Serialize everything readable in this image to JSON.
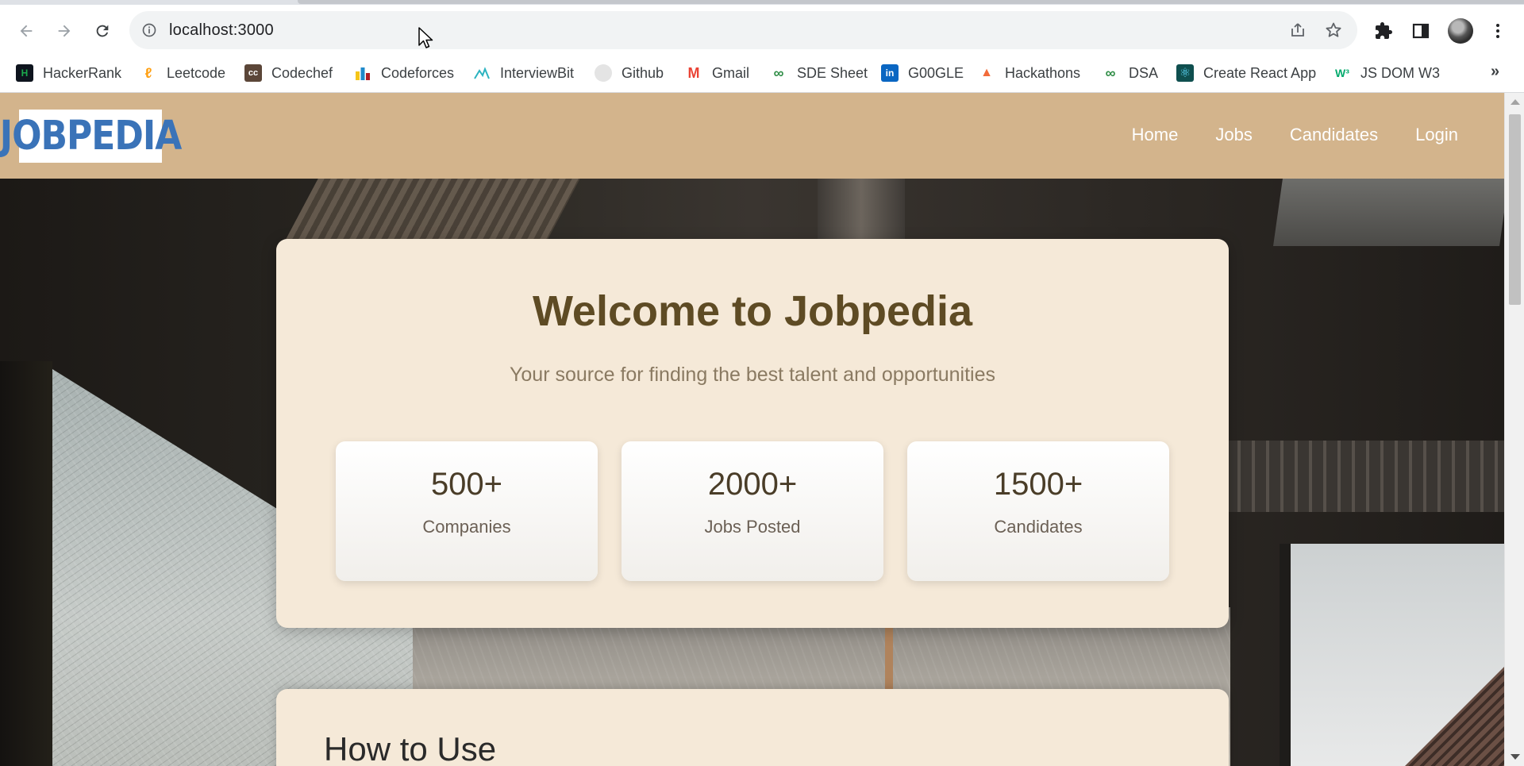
{
  "browser": {
    "url": "localhost:3000",
    "bookmarks": [
      {
        "label": "HackerRank",
        "icon": "hackerrank-icon",
        "color": "#1ba94c",
        "glyph": "H"
      },
      {
        "label": "Leetcode",
        "icon": "leetcode-icon",
        "color": "#ffa116",
        "glyph": "L"
      },
      {
        "label": "Codechef",
        "icon": "codechef-icon",
        "color": "#5b4638",
        "glyph": "cc"
      },
      {
        "label": "Codeforces",
        "icon": "codeforces-icon",
        "color": "#1f8acb",
        "glyph": ""
      },
      {
        "label": "InterviewBit",
        "icon": "interviewbit-icon",
        "color": "#2bb3c0",
        "glyph": ""
      },
      {
        "label": "Github",
        "icon": "github-icon",
        "color": "#d0d0d0",
        "glyph": ""
      },
      {
        "label": "Gmail",
        "icon": "gmail-icon",
        "color": "#ea4335",
        "glyph": "M"
      },
      {
        "label": "SDE Sheet",
        "icon": "sde-sheet-icon",
        "color": "#2f8d46",
        "glyph": "∞"
      },
      {
        "label": "G00GLE",
        "icon": "linkedin-icon",
        "color": "#0a66c2",
        "glyph": "in"
      },
      {
        "label": "Hackathons",
        "icon": "hackathons-icon",
        "color": "#f26b3a",
        "glyph": "▲"
      },
      {
        "label": "DSA",
        "icon": "dsa-icon",
        "color": "#2f8d46",
        "glyph": "∞"
      },
      {
        "label": "Create React App",
        "icon": "react-icon",
        "color": "#0f7b7b",
        "glyph": "⚛"
      },
      {
        "label": "JS DOM W3",
        "icon": "w3schools-icon",
        "color": "#04aa6d",
        "glyph": "W³"
      }
    ]
  },
  "site": {
    "logo_text": "JOBPEDIA",
    "nav": [
      "Home",
      "Jobs",
      "Candidates",
      "Login"
    ]
  },
  "welcome": {
    "title": "Welcome to Jobpedia",
    "subtitle": "Your source for finding the best talent and opportunities",
    "stats": [
      {
        "value": "500+",
        "label": "Companies"
      },
      {
        "value": "2000+",
        "label": "Jobs Posted"
      },
      {
        "value": "1500+",
        "label": "Candidates"
      }
    ]
  },
  "howto": {
    "title": "How to Use"
  },
  "colors": {
    "header": "#d3b48c",
    "card": "#f5e9d8",
    "title": "#5e4b24",
    "logo": "#3a73b8"
  }
}
